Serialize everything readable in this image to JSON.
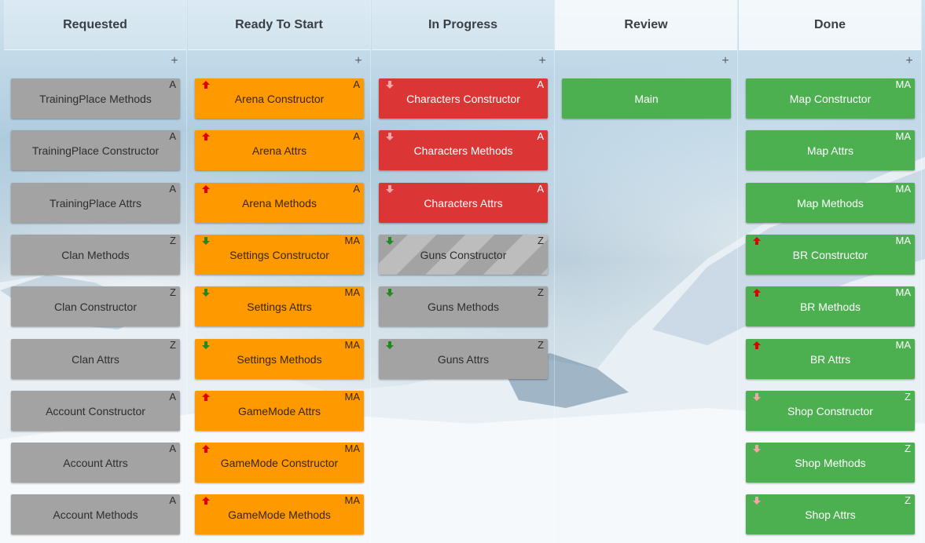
{
  "board": {
    "add_symbol": "+",
    "columns": [
      {
        "title": "Requested",
        "cards": [
          {
            "title": "TrainingPlace Methods",
            "assignee": "A",
            "color": "gray",
            "priority": "none"
          },
          {
            "title": "TrainingPlace Constructor",
            "assignee": "A",
            "color": "gray",
            "priority": "none"
          },
          {
            "title": "TrainingPlace Attrs",
            "assignee": "A",
            "color": "gray",
            "priority": "none"
          },
          {
            "title": "Clan Methods",
            "assignee": "Z",
            "color": "gray",
            "priority": "none"
          },
          {
            "title": "Clan Constructor",
            "assignee": "Z",
            "color": "gray",
            "priority": "none"
          },
          {
            "title": "Clan Attrs",
            "assignee": "Z",
            "color": "gray",
            "priority": "none"
          },
          {
            "title": "Account Constructor",
            "assignee": "A",
            "color": "gray",
            "priority": "none"
          },
          {
            "title": "Account Attrs",
            "assignee": "A",
            "color": "gray",
            "priority": "none"
          },
          {
            "title": "Account Methods",
            "assignee": "A",
            "color": "gray",
            "priority": "none"
          }
        ]
      },
      {
        "title": "Ready To Start",
        "cards": [
          {
            "title": "Arena Constructor",
            "assignee": "A",
            "color": "orange",
            "priority": "high"
          },
          {
            "title": "Arena Attrs",
            "assignee": "A",
            "color": "orange",
            "priority": "high"
          },
          {
            "title": "Arena Methods",
            "assignee": "A",
            "color": "orange",
            "priority": "high"
          },
          {
            "title": "Settings Constructor",
            "assignee": "MA",
            "color": "orange",
            "priority": "low"
          },
          {
            "title": "Settings Attrs",
            "assignee": "MA",
            "color": "orange",
            "priority": "low"
          },
          {
            "title": "Settings Methods",
            "assignee": "MA",
            "color": "orange",
            "priority": "low"
          },
          {
            "title": "GameMode Attrs",
            "assignee": "MA",
            "color": "orange",
            "priority": "high"
          },
          {
            "title": "GameMode Constructor",
            "assignee": "MA",
            "color": "orange",
            "priority": "high"
          },
          {
            "title": "GameMode Methods",
            "assignee": "MA",
            "color": "orange",
            "priority": "high"
          }
        ]
      },
      {
        "title": "In Progress",
        "cards": [
          {
            "title": "Characters Constructor",
            "assignee": "A",
            "color": "red",
            "priority": "lowest"
          },
          {
            "title": "Characters Methods",
            "assignee": "A",
            "color": "red",
            "priority": "lowest"
          },
          {
            "title": "Characters Attrs",
            "assignee": "A",
            "color": "red",
            "priority": "lowest"
          },
          {
            "title": "Guns Constructor",
            "assignee": "Z",
            "color": "striped",
            "priority": "low"
          },
          {
            "title": "Guns Methods",
            "assignee": "Z",
            "color": "gray",
            "priority": "low"
          },
          {
            "title": "Guns Attrs",
            "assignee": "Z",
            "color": "gray",
            "priority": "low"
          }
        ]
      },
      {
        "title": "Review",
        "cards": [
          {
            "title": "Main",
            "assignee": "",
            "color": "green",
            "priority": "none"
          }
        ]
      },
      {
        "title": "Done",
        "cards": [
          {
            "title": "Map Constructor",
            "assignee": "MA",
            "color": "green",
            "priority": "none"
          },
          {
            "title": "Map Attrs",
            "assignee": "MA",
            "color": "green",
            "priority": "none"
          },
          {
            "title": "Map Methods",
            "assignee": "MA",
            "color": "green",
            "priority": "none"
          },
          {
            "title": "BR Constructor",
            "assignee": "MA",
            "color": "green",
            "priority": "high"
          },
          {
            "title": "BR Methods",
            "assignee": "MA",
            "color": "green",
            "priority": "high"
          },
          {
            "title": "BR Attrs",
            "assignee": "MA",
            "color": "green",
            "priority": "high"
          },
          {
            "title": "Shop Constructor",
            "assignee": "Z",
            "color": "green",
            "priority": "lowest"
          },
          {
            "title": "Shop Methods",
            "assignee": "Z",
            "color": "green",
            "priority": "lowest"
          },
          {
            "title": "Shop Attrs",
            "assignee": "Z",
            "color": "green",
            "priority": "lowest"
          }
        ]
      }
    ]
  },
  "priority_colors": {
    "high": "#e00000",
    "low": "#1f8a1f",
    "lowest": "#f2a6a6"
  },
  "priority_icons": {
    "high": "arrow-up-icon",
    "low": "arrow-down-icon",
    "lowest": "arrow-down-icon"
  }
}
